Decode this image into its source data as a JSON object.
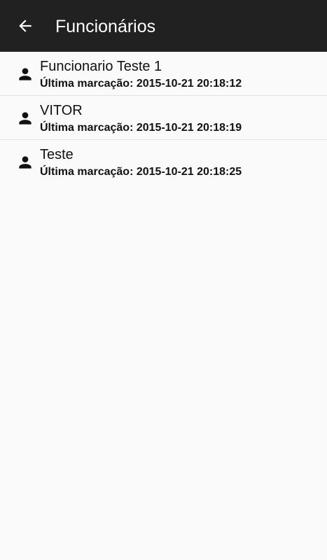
{
  "header": {
    "title": "Funcionários",
    "back_icon": "arrow-back-icon"
  },
  "employees": [
    {
      "name": "Funcionario Teste 1",
      "last_mark_label": "Última marcação:",
      "last_mark_value": "2015-10-21 20:18:12",
      "icon": "person-icon"
    },
    {
      "name": "VITOR",
      "last_mark_label": "Última marcação:",
      "last_mark_value": "2015-10-21 20:18:19",
      "icon": "person-icon"
    },
    {
      "name": "Teste",
      "last_mark_label": "Última marcação:",
      "last_mark_value": "2015-10-21 20:18:25",
      "icon": "person-icon"
    }
  ],
  "colors": {
    "app_bar": "#212121",
    "background": "#fafafa",
    "divider": "#e2e2e2",
    "text": "#111111"
  }
}
